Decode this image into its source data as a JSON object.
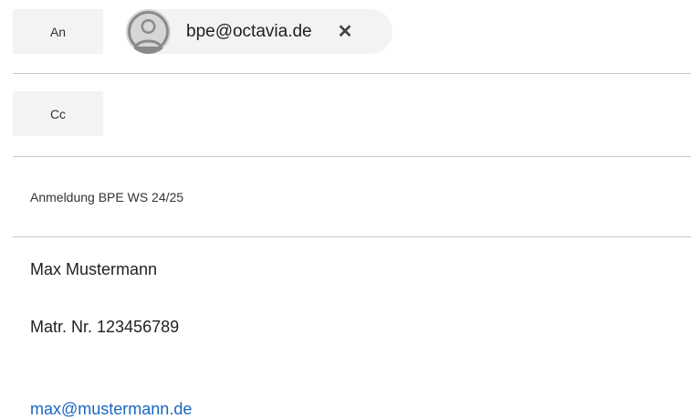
{
  "header": {
    "to_label": "An",
    "cc_label": "Cc"
  },
  "recipients": [
    {
      "email": "bpe@octavia.de",
      "remove_icon": "close-icon",
      "avatar_icon": "person-avatar-icon"
    }
  ],
  "subject": "Anmeldung BPE WS 24/25",
  "body": {
    "line1": "Max Mustermann",
    "line2": "Matr. Nr. 123456789",
    "link": "max@mustermann.de"
  },
  "colors": {
    "link": "#1a66c2",
    "chip_background": "#f3f3f3",
    "divider": "#c8c8c8"
  }
}
